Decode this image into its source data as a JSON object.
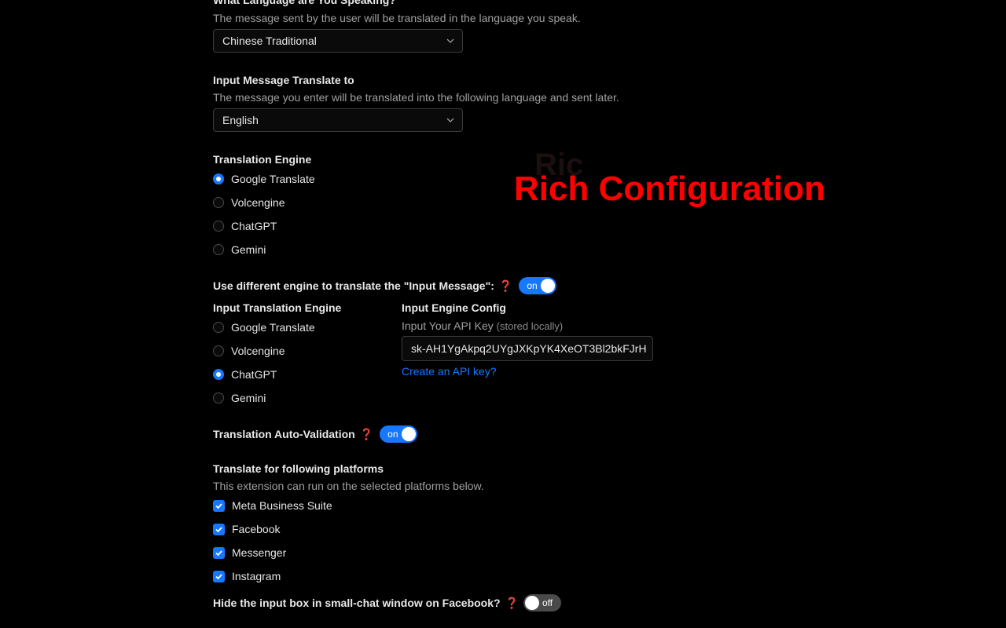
{
  "speak_lang": {
    "heading": "What Language are You Speaking?",
    "description": "The message sent by the user will be translated in the language you speak.",
    "value": "Chinese Traditional"
  },
  "input_translate": {
    "heading": "Input Message Translate to",
    "description": "The message you enter will be translated into the following language and sent later.",
    "value": "English"
  },
  "engine": {
    "heading": "Translation Engine",
    "options": [
      "Google Translate",
      "Volcengine",
      "ChatGPT",
      "Gemini"
    ],
    "selected": "Google Translate"
  },
  "diff_engine": {
    "label": "Use different engine to translate the \"Input Message\":",
    "help": "❓",
    "toggle": "on"
  },
  "input_engine": {
    "heading": "Input Translation Engine",
    "options": [
      "Google Translate",
      "Volcengine",
      "ChatGPT",
      "Gemini"
    ],
    "selected": "ChatGPT"
  },
  "engine_config": {
    "heading": "Input Engine Config",
    "api_label": "Input Your API Key",
    "api_hint": "(stored locally)",
    "api_value": "sk-AH1YgAkpq2UYgJXKpYK4XeOT3Bl2bkFJrH",
    "create_link": "Create an API key?"
  },
  "auto_validation": {
    "label": "Translation Auto-Validation",
    "help": "❓",
    "toggle": "on"
  },
  "platforms": {
    "heading": "Translate for following platforms",
    "description": "This extension can run on the selected platforms below.",
    "items": [
      "Meta Business Suite",
      "Facebook",
      "Messenger",
      "Instagram"
    ]
  },
  "hide_input": {
    "label": "Hide the input box in small-chat window on Facebook?",
    "help": "❓",
    "toggle": "off"
  },
  "overlay": {
    "title": "Rich Configuration",
    "ghost": "Ric"
  },
  "colors": {
    "accent": "#1677ff",
    "overlay_red": "#ff0000",
    "background": "#000000"
  }
}
